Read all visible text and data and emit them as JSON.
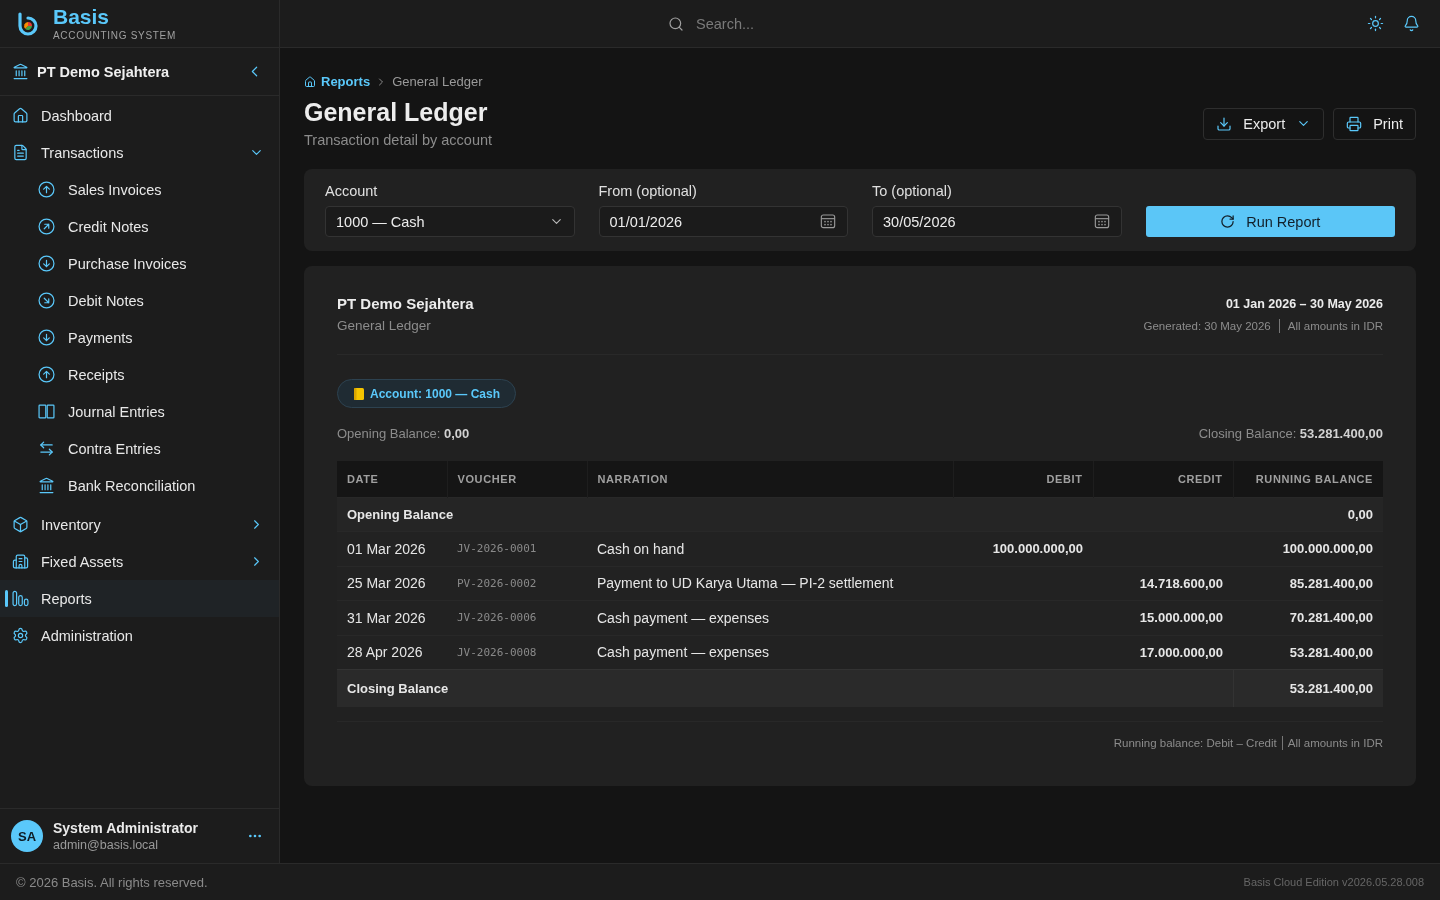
{
  "header": {
    "brand": {
      "name": "Basis",
      "tagline": "ACCOUNTING SYSTEM"
    },
    "search": {
      "placeholder": "Search..."
    }
  },
  "sidebar": {
    "company": "PT Demo Sejahtera",
    "items": [
      {
        "kind": "link",
        "label": "Dashboard",
        "selected": false
      },
      {
        "kind": "group",
        "label": "Transactions",
        "selected": false,
        "expanded": true,
        "children": [
          {
            "label": "Sales Invoices",
            "selected": false
          },
          {
            "label": "Credit Notes",
            "selected": false
          },
          {
            "label": "Purchase Invoices",
            "selected": false
          },
          {
            "label": "Debit Notes",
            "selected": false
          },
          {
            "label": "Payments",
            "selected": false
          },
          {
            "label": "Receipts",
            "selected": false
          },
          {
            "label": "Journal Entries",
            "selected": false
          },
          {
            "label": "Contra Entries",
            "selected": false
          },
          {
            "label": "Bank Reconciliation",
            "selected": false
          }
        ]
      },
      {
        "kind": "group",
        "label": "Inventory",
        "selected": false,
        "expanded": false
      },
      {
        "kind": "group",
        "label": "Fixed Assets",
        "selected": false,
        "expanded": false
      },
      {
        "kind": "link",
        "label": "Reports",
        "selected": true
      },
      {
        "kind": "link",
        "label": "Administration",
        "selected": false
      }
    ],
    "user": {
      "initials": "SA",
      "name": "System Administrator",
      "email": "admin@basis.local"
    }
  },
  "page": {
    "breadcrumb": [
      {
        "kind": "link",
        "label": "Reports"
      },
      {
        "kind": "current",
        "label": "General Ledger"
      }
    ],
    "title": "General Ledger",
    "subtitle": "Transaction detail by account",
    "actions": [
      {
        "kind": "menu",
        "label": "Export"
      },
      {
        "kind": "plain",
        "label": "Print"
      }
    ]
  },
  "filters": {
    "fields": [
      {
        "kind": "select",
        "label": "Account",
        "value": "1000 — Cash"
      },
      {
        "kind": "date",
        "label": "From (optional)",
        "value": "01/01/2026"
      },
      {
        "kind": "date",
        "label": "To (optional)",
        "value": "30/05/2026"
      }
    ],
    "submit": "Run Report"
  },
  "report": {
    "company": "PT Demo Sejahtera",
    "title": "General Ledger",
    "period": "01 Jan 2026 – 30 May 2026",
    "generated": "Generated: 30 May 2026",
    "currency_note": "All amounts in IDR",
    "account_chip": "Account: 1000 — Cash",
    "opening": "Opening Balance: **0,00**",
    "closing": "Closing Balance: **53.281.400,00**",
    "table": {
      "columns": [
        "DATE",
        "VOUCHER",
        "NARRATION",
        "DEBIT",
        "CREDIT",
        "RUNNING BALANCE"
      ],
      "rows": [
        {
          "kind": "opening",
          "label": "Opening Balance",
          "balance": "0,00"
        },
        {
          "kind": "entry",
          "date": "01 Mar 2026",
          "voucher": "JV-2026-0001",
          "narration": "Cash on hand",
          "debit": "100.000.000,00",
          "balance": "100.000.000,00"
        },
        {
          "kind": "entry",
          "date": "25 Mar 2026",
          "voucher": "PV-2026-0002",
          "narration": "Payment to UD Karya Utama — PI-2 settlement",
          "credit": "14.718.600,00",
          "balance": "85.281.400,00"
        },
        {
          "kind": "entry",
          "date": "31 Mar 2026",
          "voucher": "JV-2026-0006",
          "narration": "Cash payment — expenses",
          "credit": "15.000.000,00",
          "balance": "70.281.400,00"
        },
        {
          "kind": "entry",
          "date": "28 Apr 2026",
          "voucher": "JV-2026-0008",
          "narration": "Cash payment — expenses",
          "credit": "17.000.000,00",
          "balance": "53.281.400,00"
        },
        {
          "kind": "closing",
          "label": "Closing Balance",
          "balance": "53.281.400,00"
        }
      ]
    },
    "footnote": [
      "Running balance: Debit – Credit",
      "All amounts in IDR"
    ]
  },
  "footer": {
    "copyright": "© 2026 Basis. All rights reserved.",
    "version": "Basis Cloud Edition v2026.05.28.008"
  }
}
